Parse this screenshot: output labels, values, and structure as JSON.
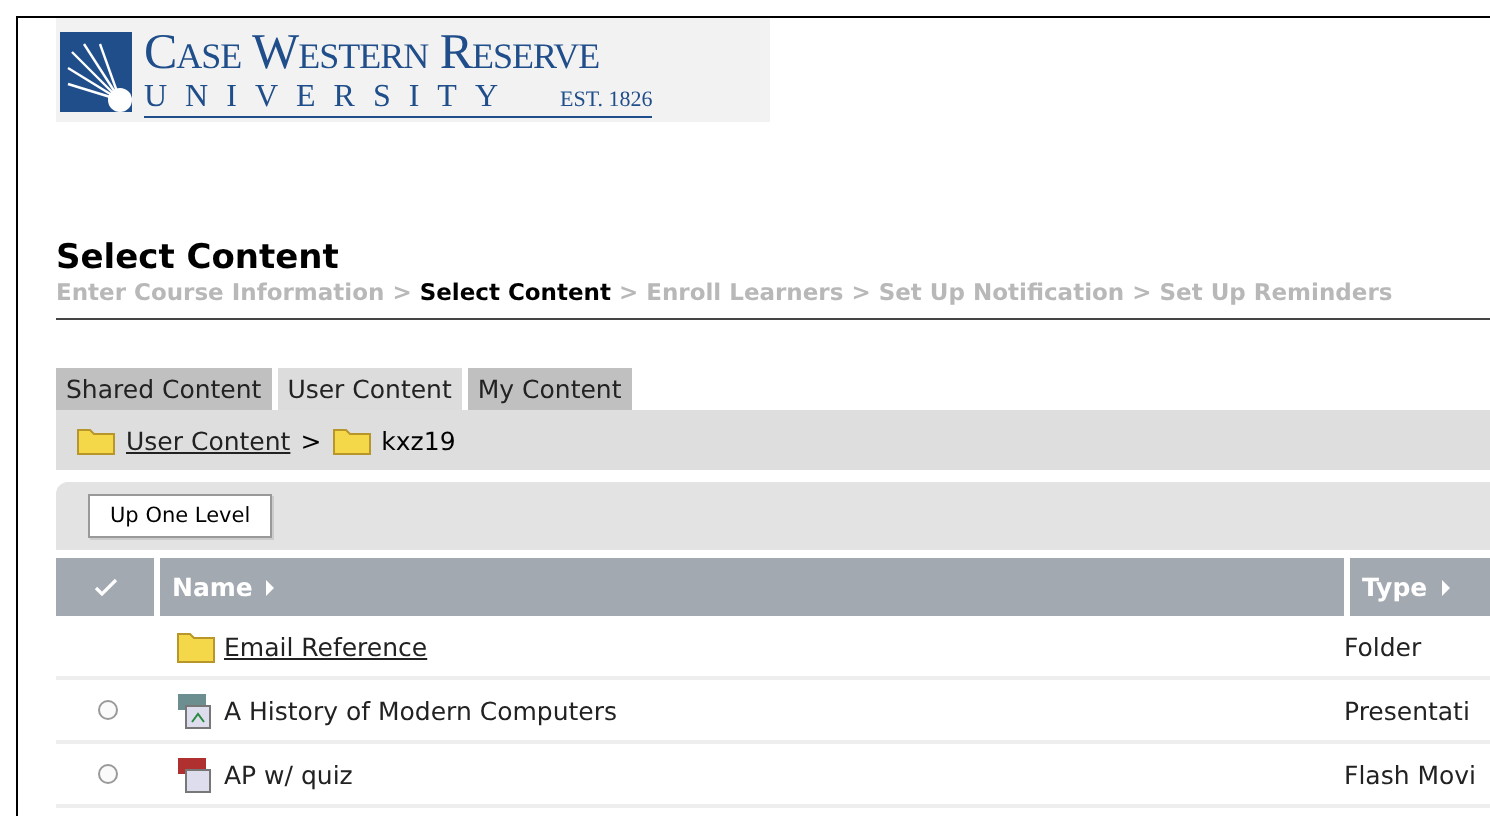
{
  "logo": {
    "line1": "Case Western Reserve",
    "line2": "UNIVERSITY",
    "established": "EST. 1826"
  },
  "page_title": "Select Content",
  "steps": [
    {
      "label": "Enter Course Information",
      "selected": false
    },
    {
      "label": "Select Content",
      "selected": true
    },
    {
      "label": "Enroll Learners",
      "selected": false
    },
    {
      "label": "Set Up Notification",
      "selected": false
    },
    {
      "label": "Set Up Reminders",
      "selected": false
    }
  ],
  "step_separator": ">",
  "tabs": [
    {
      "label": "Shared Content",
      "selected": false
    },
    {
      "label": "User Content",
      "selected": true
    },
    {
      "label": "My Content",
      "selected": false
    }
  ],
  "breadcrumb": [
    {
      "label": "User Content",
      "kind": "link"
    },
    {
      "label": "kxz19",
      "kind": "current"
    }
  ],
  "breadcrumb_separator": ">",
  "up_button": "Up One Level",
  "table": {
    "columns": [
      {
        "label": "Name"
      },
      {
        "label": "Type"
      }
    ],
    "rows": [
      {
        "kind": "folder",
        "name": "Email Reference",
        "type": "Folder"
      },
      {
        "kind": "presentation",
        "name": "A History of Modern Computers",
        "type": "Presentati",
        "selected": false
      },
      {
        "kind": "flash",
        "name": "AP w/ quiz",
        "type": "Flash Movi",
        "selected": false
      }
    ]
  }
}
